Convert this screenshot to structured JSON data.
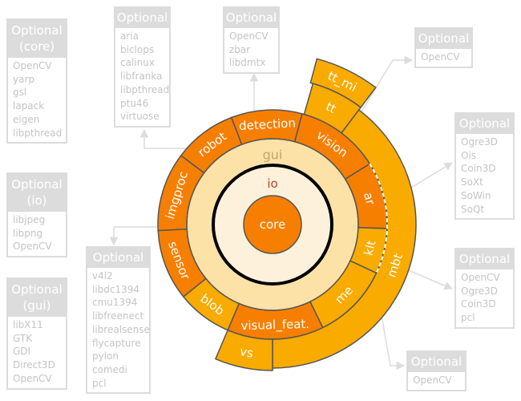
{
  "colors": {
    "module_dark": "#f77f00",
    "module_light": "#f9ab00",
    "gui_ring": "#fde2a8",
    "io_ring": "#fdf1dc",
    "core": "#f77f00",
    "border": "#555555",
    "gui_label": "#c9a468",
    "io_label": "#c0392b",
    "box_gray": "#dcdcdc"
  },
  "wheel": {
    "core": "core",
    "io": "io",
    "gui": "gui",
    "modules": [
      "robot",
      "detection",
      "vision",
      "ar",
      "klt",
      "me",
      "visual_feat.",
      "blob",
      "sensor",
      "imgproc"
    ],
    "outer": [
      "tt",
      "tt_mi",
      "mbt",
      "vs"
    ]
  },
  "boxes": {
    "core": {
      "title": "Optional",
      "subtitle": "(core)",
      "items": [
        "OpenCV",
        "yarp",
        "gsl",
        "lapack",
        "eigen",
        "libpthread"
      ]
    },
    "robot": {
      "title": "Optional",
      "items": [
        "aria",
        "biclops",
        "calinux",
        "libfranka",
        "libpthread",
        "ptu46",
        "virtuose"
      ]
    },
    "detection": {
      "title": "Optional",
      "items": [
        "OpenCV",
        "zbar",
        "libdmtx"
      ]
    },
    "vision": {
      "title": "Optional",
      "items": [
        "OpenCV"
      ]
    },
    "ar": {
      "title": "Optional",
      "items": [
        "Ogre3D",
        "Ois",
        "Coin3D",
        "SoXt",
        "SoWin",
        "SoQt"
      ]
    },
    "io": {
      "title": "Optional",
      "subtitle": "(io)",
      "items": [
        "libjpeg",
        "libpng",
        "OpenCV"
      ]
    },
    "gui": {
      "title": "Optional",
      "subtitle": "(gui)",
      "items": [
        "libX11",
        "GTK",
        "GDI",
        "Direct3D",
        "OpenCV"
      ]
    },
    "sensor": {
      "title": "Optional",
      "items": [
        "v4l2",
        "libdc1394",
        "cmu1394",
        "libfreenect",
        "librealsense",
        "flycapture",
        "pylon",
        "comedi",
        "pcl"
      ]
    },
    "mbt": {
      "title": "Optional",
      "items": [
        "OpenCV",
        "Ogre3D",
        "Coin3D",
        "pcl"
      ]
    },
    "klt": {
      "title": "Optional",
      "items": [
        "OpenCV"
      ]
    }
  }
}
